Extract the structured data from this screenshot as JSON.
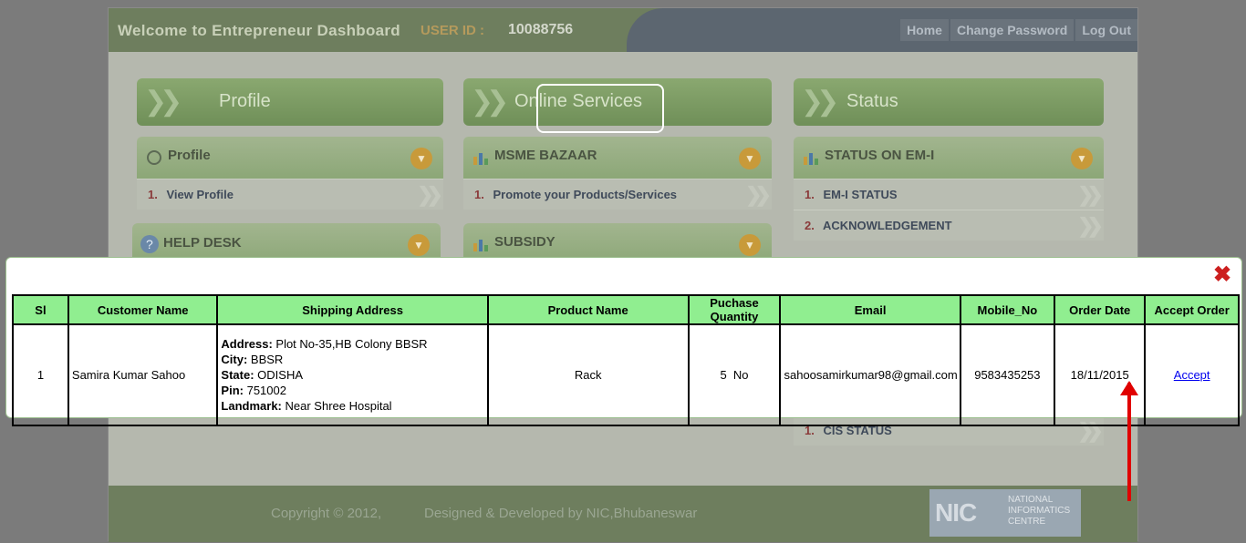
{
  "header": {
    "welcome": "Welcome to Entrepreneur Dashboard",
    "user_id_label": "USER ID :",
    "user_id_value": "10088756",
    "nav": [
      "Home",
      "Change Password",
      "Log Out"
    ]
  },
  "sections": {
    "profile": "Profile",
    "online_services": "Online Services",
    "status": "Status"
  },
  "cards": {
    "profile": {
      "title": "Profile",
      "items": [
        {
          "num": "1.",
          "label": "View Profile"
        }
      ]
    },
    "help_desk": {
      "title": "HELP DESK"
    },
    "msme_bazaar": {
      "title": "MSME BAZAAR",
      "items": [
        {
          "num": "1.",
          "label": "Promote your Products/Services"
        }
      ]
    },
    "subsidy": {
      "title": "SUBSIDY"
    },
    "status_em": {
      "title": "STATUS ON EM-I",
      "items": [
        {
          "num": "1.",
          "label": "EM-I STATUS"
        },
        {
          "num": "2.",
          "label": "ACKNOWLEDGEMENT"
        }
      ]
    },
    "cis": {
      "items": [
        {
          "num": "1.",
          "label": "CIS STATUS"
        }
      ]
    }
  },
  "footer": {
    "copyright": "Copyright © 2012,",
    "developed": "Designed & Developed by NIC,Bhubaneswar",
    "nic_mark": "NIC",
    "nic_text": [
      "NATIONAL",
      "INFORMATICS",
      "CENTRE"
    ]
  },
  "orders_table": {
    "headers": [
      "Sl",
      "Customer Name",
      "Shipping Address",
      "Product Name",
      "Puchase Quantity",
      "Email",
      "Mobile_No",
      "Order Date",
      "Accept Order"
    ],
    "row": {
      "sl": "1",
      "customer": "Samira Kumar Sahoo",
      "address_label": "Address:",
      "address": " Plot No-35,HB Colony BBSR",
      "city_label": "City:",
      "city": " BBSR",
      "state_label": "State:",
      "state": " ODISHA",
      "pin_label": "Pin:",
      "pin": " 751002",
      "landmark_label": "Landmark:",
      "landmark": " Near Shree Hospital",
      "product": "Rack",
      "quantity": "5  No",
      "email": "sahoosamirkumar98@gmail.com",
      "mobile": "9583435253",
      "order_date": "18/11/2015",
      "accept": "Accept"
    }
  },
  "colors": {
    "accent_green": "#90ee90",
    "close_red": "#cc1f1f",
    "arrow_red": "#e00000"
  }
}
